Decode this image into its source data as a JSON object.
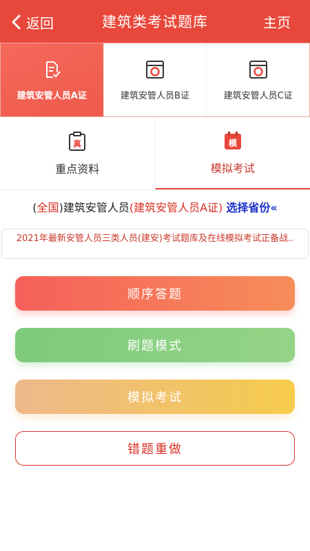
{
  "header": {
    "back_label": "返回",
    "title": "建筑类考试题库",
    "home_label": "主页"
  },
  "cert_tabs": [
    {
      "label": "建筑安管人员A证",
      "icon": "document-check-icon",
      "active": true
    },
    {
      "label": "建筑安管人员B证",
      "icon": "exam-paper-icon",
      "active": false
    },
    {
      "label": "建筑安管人员C证",
      "icon": "exam-paper-icon",
      "active": false
    }
  ],
  "nav_tabs": [
    {
      "label": "重点资料",
      "icon_char": "真",
      "icon": "clipboard-icon",
      "active": false
    },
    {
      "label": "模拟考试",
      "icon_char": "模",
      "icon": "calendar-icon",
      "active": true
    }
  ],
  "selector": {
    "open_paren": "(",
    "region": "全国",
    "close_paren": ")",
    "category": "建筑安管人员",
    "cert": "(建筑安管人员A证)",
    "choose": "选择省份«"
  },
  "notice": "2021年最新安管人员三类人员(建安)考试题库及在线模拟考试正备战..",
  "buttons": {
    "sequential": "顺序答题",
    "drill": "刷题模式",
    "mock": "模拟考试",
    "redo": "错题重做"
  },
  "colors": {
    "brand": "#e8483b",
    "link_blue": "#1a2fc7",
    "text_red": "#d82e22"
  }
}
